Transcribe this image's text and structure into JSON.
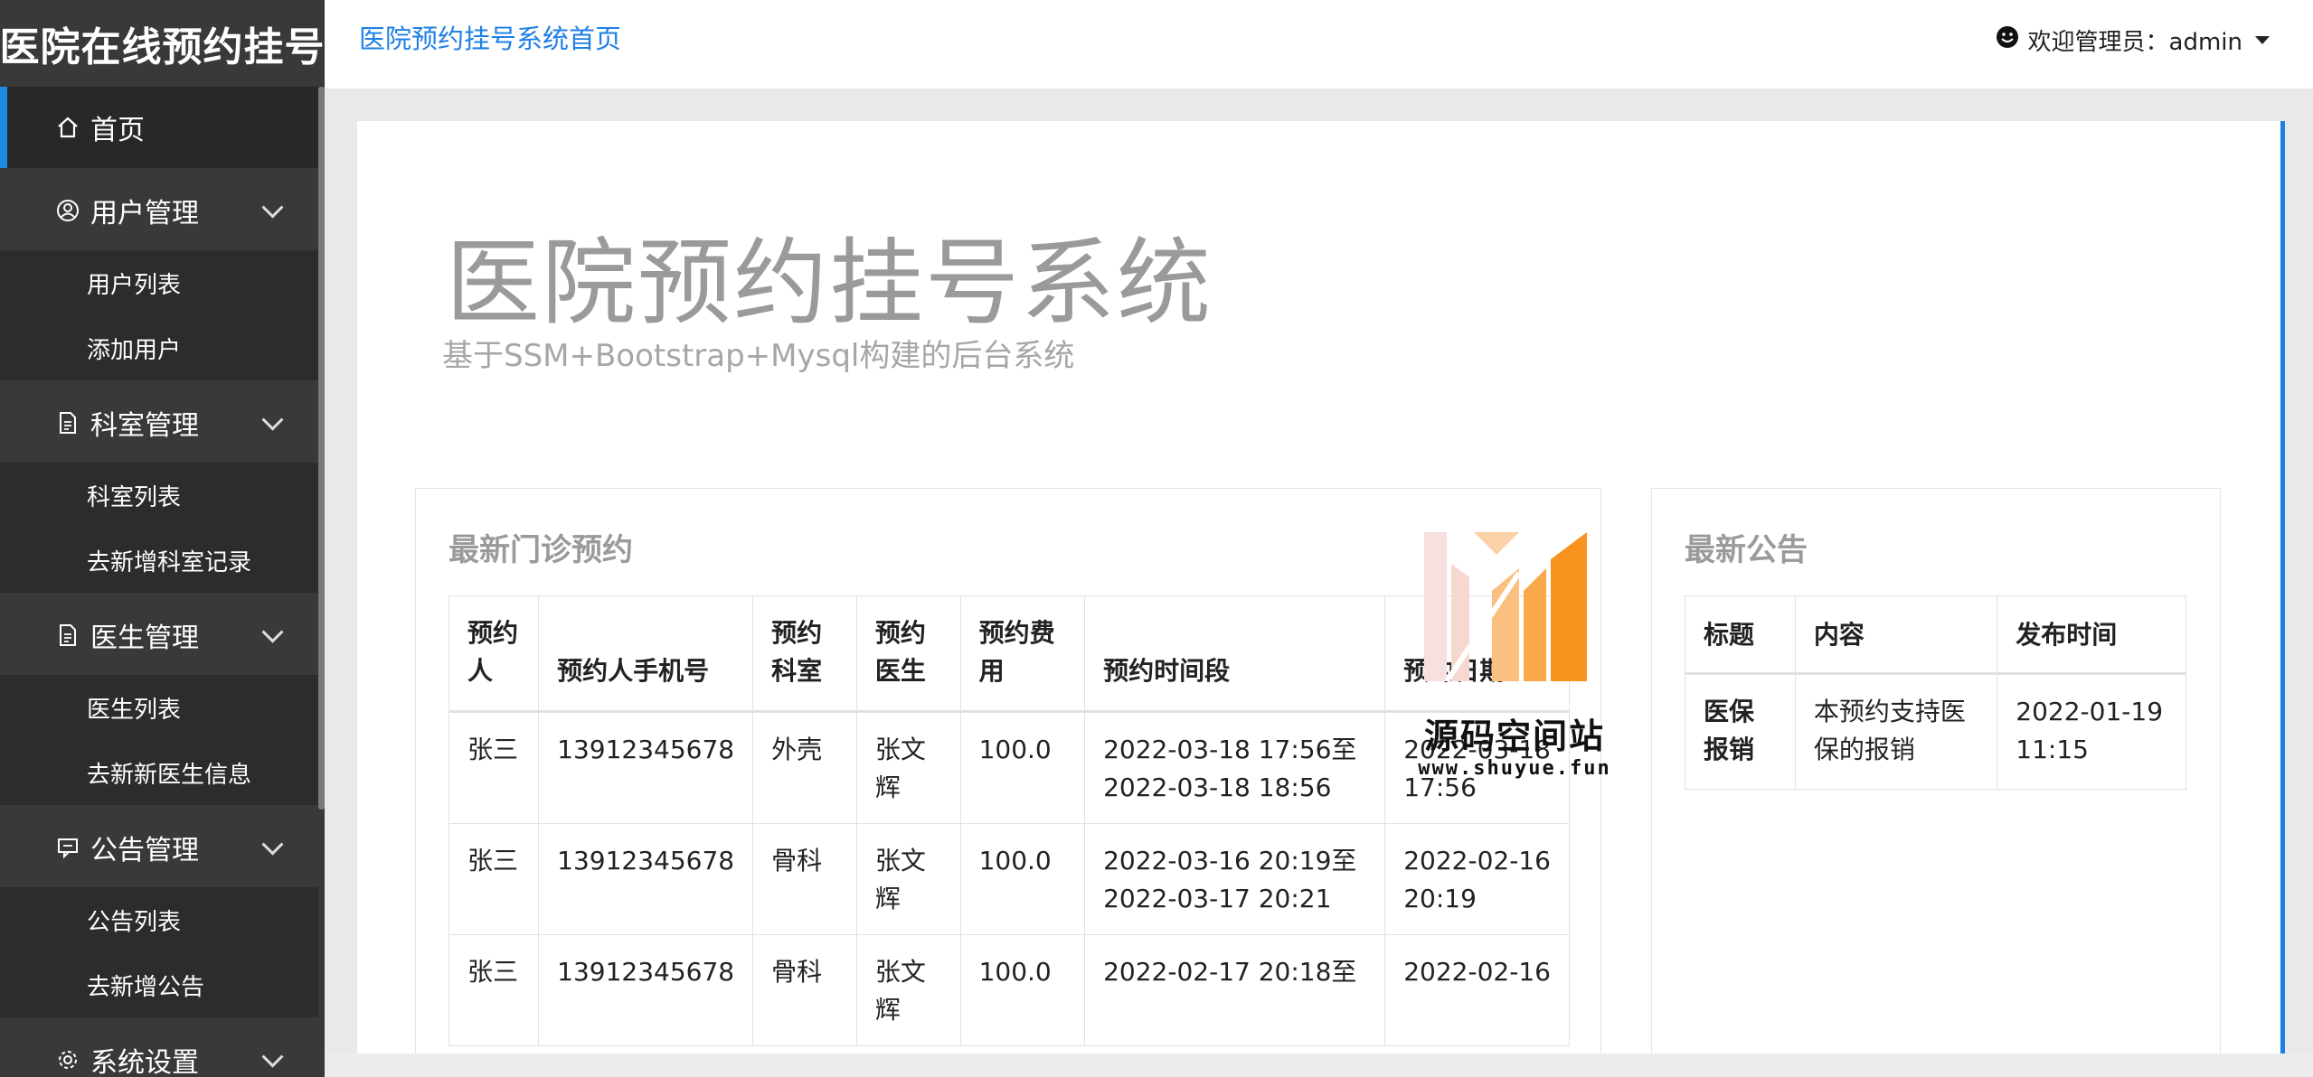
{
  "brand": "医院在线预约挂号",
  "sidebar": {
    "home": "首页",
    "groups": [
      {
        "label": "用户管理",
        "items": [
          "用户列表",
          "添加用户"
        ]
      },
      {
        "label": "科室管理",
        "items": [
          "科室列表",
          "去新增科室记录"
        ]
      },
      {
        "label": "医生管理",
        "items": [
          "医生列表",
          "去新新医生信息"
        ]
      },
      {
        "label": "公告管理",
        "items": [
          "公告列表",
          "去新增公告"
        ]
      },
      {
        "label": "系统设置",
        "items": []
      }
    ]
  },
  "topbar": {
    "home_link": "医院预约挂号系统首页",
    "user_label": "欢迎管理员：admin"
  },
  "hero": {
    "title": "医院预约挂号系统",
    "subtitle": "基于SSM+Bootstrap+Mysql构建的后台系统"
  },
  "appointments": {
    "title": "最新门诊预约",
    "headers": [
      "预约人",
      "预约人手机号",
      "预约科室",
      "预约医生",
      "预约费用",
      "预约时间段",
      "预约日期"
    ],
    "rows": [
      [
        "张三",
        "13912345678",
        "外壳",
        "张文辉",
        "100.0",
        "2022-03-18 17:56至2022-03-18 18:56",
        "2022-03-18 17:56"
      ],
      [
        "张三",
        "13912345678",
        "骨科",
        "张文辉",
        "100.0",
        "2022-03-16 20:19至2022-03-17 20:21",
        "2022-02-16 20:19"
      ],
      [
        "张三",
        "13912345678",
        "骨科",
        "张文辉",
        "100.0",
        "2022-02-17 20:18至",
        "2022-02-16"
      ]
    ]
  },
  "notices": {
    "title": "最新公告",
    "headers": [
      "标题",
      "内容",
      "发布时间"
    ],
    "rows": [
      [
        "医保报销",
        "本预约支持医保的报销",
        "2022-01-19 11:15"
      ]
    ]
  },
  "watermark": {
    "name": "源码空间站",
    "url": "www.shuyue.fun"
  },
  "colors": {
    "sidebar_bg": "#393939",
    "accent": "#1e7fe6",
    "watermark_orange": "#f7931e"
  }
}
